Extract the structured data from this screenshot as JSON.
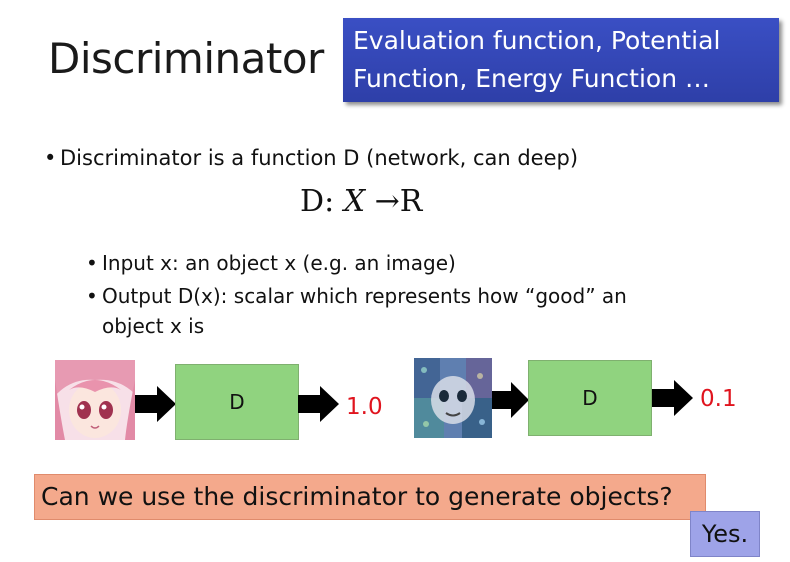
{
  "slide": {
    "title": "Discriminator",
    "callout": {
      "line1": "Evaluation function, Potential",
      "line2": "Function, Energy Function …"
    },
    "bullet_main": "Discriminator is a function D (network, can deep)",
    "formula": {
      "lhs": "D",
      "colon": ":",
      "domain": "X",
      "arrow": "→",
      "codomain": "R"
    },
    "sub_bullets": [
      "Input x: an object x (e.g. an image)",
      "Output D(x): scalar which represents how “good” an object x is"
    ],
    "examples": [
      {
        "image": "anime-face-image",
        "box_label": "D",
        "score": "1.0",
        "score_color": "#e0141e"
      },
      {
        "image": "noisy-generated-image",
        "box_label": "D",
        "score": "0.1",
        "score_color": "#e0141e"
      }
    ],
    "question": "Can we use the discriminator to generate objects?",
    "answer": "Yes.",
    "colors": {
      "callout_bg": "#3a4fc4",
      "d_box": "#90d37f",
      "question_bg": "#f4a98c",
      "answer_bg": "#9ea3e8"
    }
  }
}
